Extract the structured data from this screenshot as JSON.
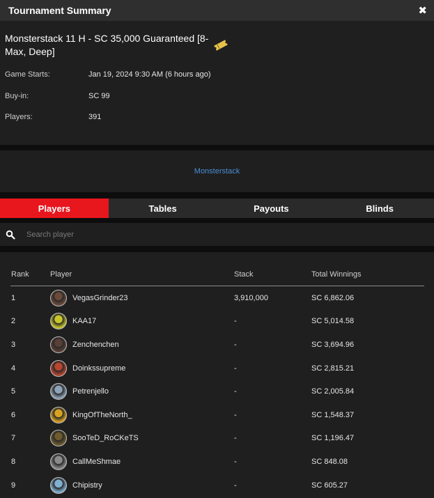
{
  "header": {
    "title": "Tournament Summary",
    "close_glyph": "✖"
  },
  "tournament": {
    "name": "Monsterstack 11 H - SC 35,000 Guaranteed [8-Max, Deep]",
    "ticket_icon": "ticket-icon",
    "fields": [
      {
        "label": "Game Starts:",
        "value": "Jan 19, 2024 9:30 AM (6 hours ago)"
      },
      {
        "label": "Buy-in:",
        "value": "SC 99"
      },
      {
        "label": "Players:",
        "value": "391"
      }
    ]
  },
  "series_link": "Monsterstack",
  "tabs": [
    {
      "label": "Players",
      "active": true
    },
    {
      "label": "Tables",
      "active": false
    },
    {
      "label": "Payouts",
      "active": false
    },
    {
      "label": "Blinds",
      "active": false
    }
  ],
  "search": {
    "placeholder": "Search player",
    "value": ""
  },
  "table": {
    "columns": {
      "rank": "Rank",
      "player": "Player",
      "stack": "Stack",
      "winnings": "Total Winnings"
    },
    "rows": [
      {
        "rank": "1",
        "player": "VegasGrinder23",
        "stack": "3,910,000",
        "winnings": "SC 6,862.06",
        "avatar_color": "#6b4a3a"
      },
      {
        "rank": "2",
        "player": "KAA17",
        "stack": "-",
        "winnings": "SC 5,014.58",
        "avatar_color": "#c9c62a"
      },
      {
        "rank": "3",
        "player": "Zenchenchen",
        "stack": "-",
        "winnings": "SC 3,694.96",
        "avatar_color": "#5a3f36"
      },
      {
        "rank": "4",
        "player": "Doinkssupreme",
        "stack": "-",
        "winnings": "SC 2,815.21",
        "avatar_color": "#b8452e"
      },
      {
        "rank": "5",
        "player": "Petrenjello",
        "stack": "-",
        "winnings": "SC 2,005.84",
        "avatar_color": "#8ea3b8"
      },
      {
        "rank": "6",
        "player": "KingOfTheNorth_",
        "stack": "-",
        "winnings": "SC 1,548.37",
        "avatar_color": "#d9a21e"
      },
      {
        "rank": "7",
        "player": "SooTeD_RoCKeTS",
        "stack": "-",
        "winnings": "SC 1,196.47",
        "avatar_color": "#6e5a2c"
      },
      {
        "rank": "8",
        "player": "CallMeShmae",
        "stack": "-",
        "winnings": "SC 848.08",
        "avatar_color": "#8a8a8a"
      },
      {
        "rank": "9",
        "player": "Chipistry",
        "stack": "-",
        "winnings": "SC 605.27",
        "avatar_color": "#7fb0d0"
      }
    ]
  },
  "colors": {
    "accent": "#e8161d",
    "link": "#4a8fd6",
    "panel": "#1f1f1f",
    "titlebar": "#2f2f2f"
  }
}
